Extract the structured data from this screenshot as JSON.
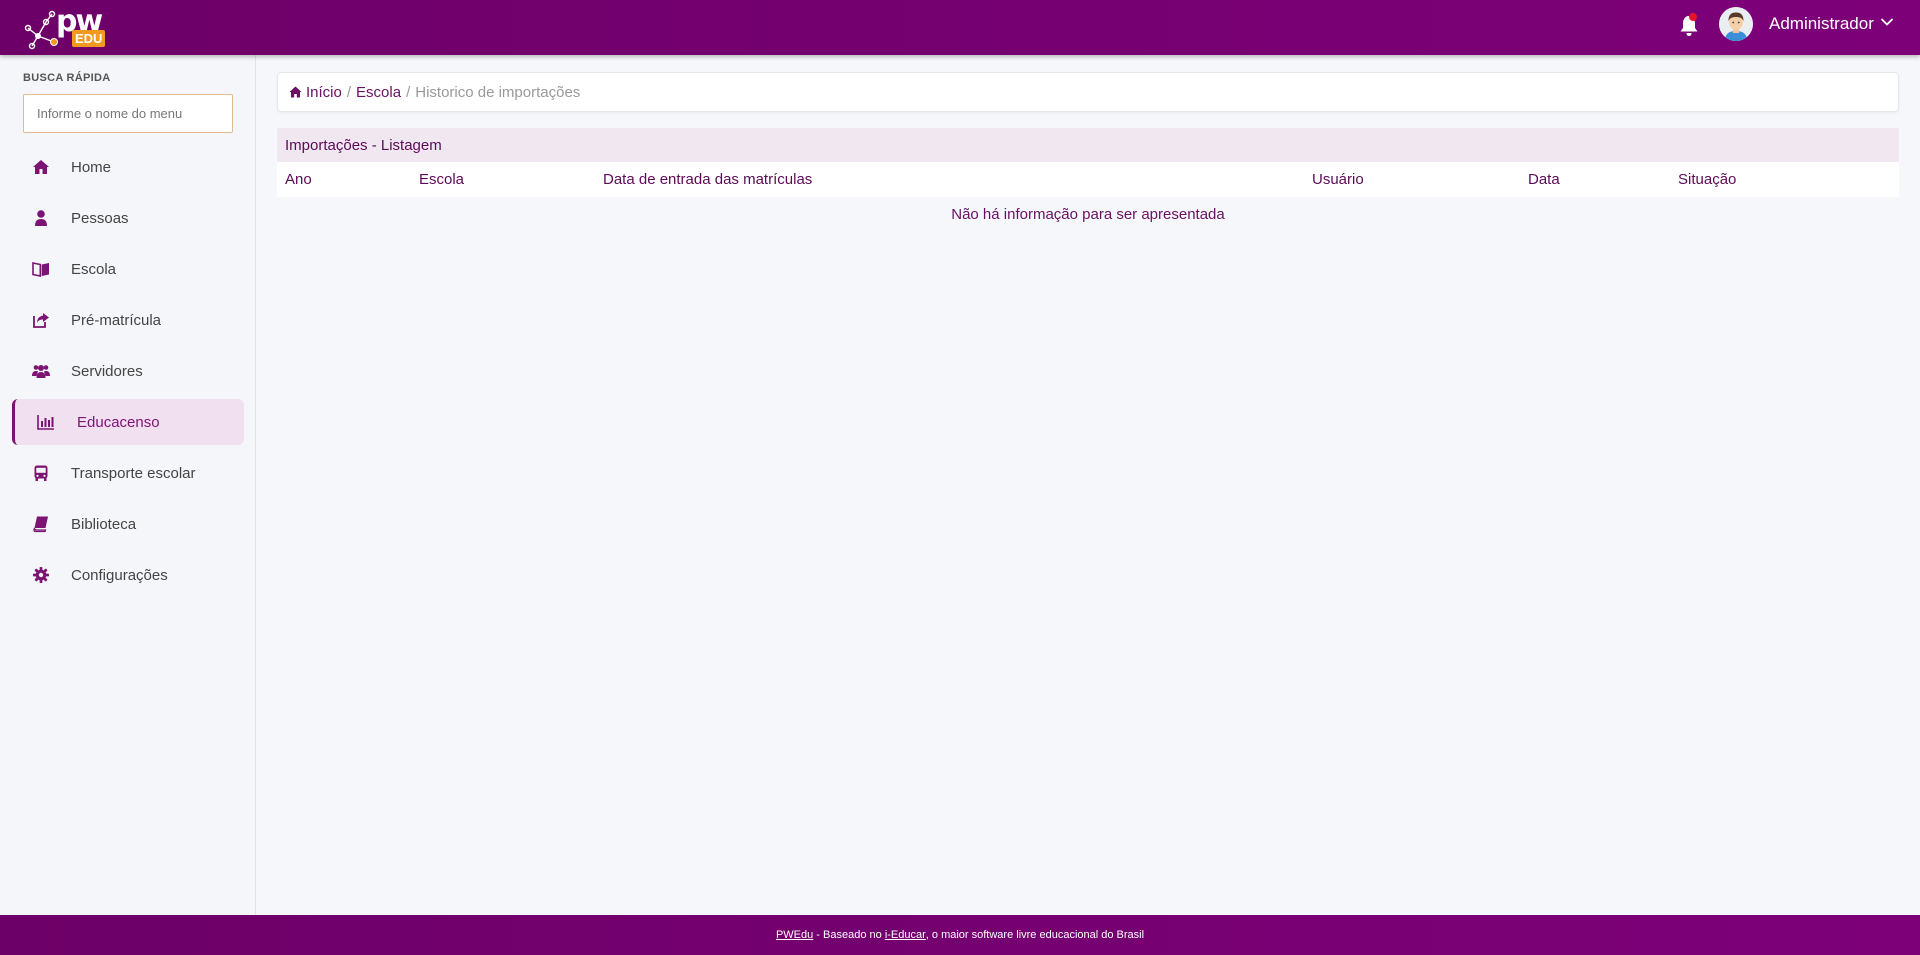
{
  "brand": {
    "logo_text": "pw",
    "logo_badge": "EDU",
    "primary_color": "#760070",
    "accent_color": "#f39a1e"
  },
  "topbar": {
    "user_name": "Administrador",
    "notification_icon": "bell-icon",
    "notification_dot_color": "#e8132a"
  },
  "sidebar": {
    "quick_search_label": "BUSCA RÁPIDA",
    "quick_search_placeholder": "Informe o nome do menu",
    "items": [
      {
        "label": "Home",
        "icon": "home-icon"
      },
      {
        "label": "Pessoas",
        "icon": "user-icon"
      },
      {
        "label": "Escola",
        "icon": "book-open-icon"
      },
      {
        "label": "Pré-matrícula",
        "icon": "share-icon"
      },
      {
        "label": "Servidores",
        "icon": "users-icon"
      },
      {
        "label": "Educacenso",
        "icon": "bar-chart-icon",
        "active": true
      },
      {
        "label": "Transporte escolar",
        "icon": "bus-icon"
      },
      {
        "label": "Biblioteca",
        "icon": "book-icon"
      },
      {
        "label": "Configurações",
        "icon": "gear-icon"
      }
    ]
  },
  "breadcrumb": {
    "home": "Início",
    "section": "Escola",
    "current": "Historico de importações",
    "separator": "/"
  },
  "panel": {
    "title": "Importações - Listagem",
    "columns": [
      "Ano",
      "Escola",
      "Data de entrada das matrículas",
      "Usuário",
      "Data",
      "Situação"
    ],
    "empty_message": "Não há informação para ser apresentada"
  },
  "footer": {
    "link1": "PWEdu",
    "text1": " - Baseado no ",
    "link2": "i-Educar",
    "text2": ", o maior software livre educacional do Brasil"
  }
}
